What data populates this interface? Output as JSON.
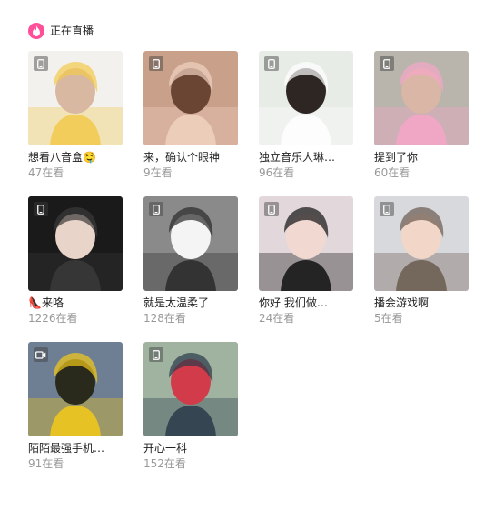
{
  "section": {
    "title": "正在直播",
    "icon": "flame-icon",
    "accent": "#ff4f98"
  },
  "streams": [
    {
      "title": "想看八音盒🤤",
      "viewers": "47在看",
      "device": "phone-icon",
      "palette": {
        "bg": "#f3f1ee",
        "fg": "#d8b8a0",
        "accent": "#f2c94c"
      }
    },
    {
      "title": "来，确认个眼神",
      "viewers": "9在看",
      "device": "phone-icon",
      "palette": {
        "bg": "#c9a08a",
        "fg": "#6b4534",
        "accent": "#f0d2c0"
      }
    },
    {
      "title": "独立音乐人琳…",
      "viewers": "96在看",
      "device": "phone-icon",
      "palette": {
        "bg": "#e8ece6",
        "fg": "#2d2623",
        "accent": "#ffffff"
      }
    },
    {
      "title": "提到了你",
      "viewers": "60在看",
      "device": "phone-icon",
      "palette": {
        "bg": "#b9b4ac",
        "fg": "#d9b6a6",
        "accent": "#f5a6c8"
      }
    },
    {
      "title": "👠来咯",
      "viewers": "1226在看",
      "device": "phone-icon",
      "palette": {
        "bg": "#1a1a1a",
        "fg": "#e9d4c9",
        "accent": "#3a3a3a"
      }
    },
    {
      "title": "就是太温柔了",
      "viewers": "128在看",
      "device": "phone-icon",
      "palette": {
        "bg": "#8a8a8a",
        "fg": "#f4f4f4",
        "accent": "#2a2a2a"
      }
    },
    {
      "title": "你好 我们做…",
      "viewers": "24在看",
      "device": "phone-icon",
      "palette": {
        "bg": "#e2d8db",
        "fg": "#f1d9d2",
        "accent": "#111111"
      }
    },
    {
      "title": "播会游戏啊",
      "viewers": "5在看",
      "device": "phone-icon",
      "palette": {
        "bg": "#d7d9dd",
        "fg": "#f2d6c8",
        "accent": "#6a5a4e"
      }
    },
    {
      "title": "陌陌最强手机…",
      "viewers": "91在看",
      "device": "camera-icon",
      "palette": {
        "bg": "#6e7f93",
        "fg": "#2a2a1c",
        "accent": "#f4c91a"
      }
    },
    {
      "title": "开心一科",
      "viewers": "152在看",
      "device": "phone-icon",
      "palette": {
        "bg": "#9fb3a0",
        "fg": "#d23b4a",
        "accent": "#2a3a4a"
      }
    }
  ]
}
